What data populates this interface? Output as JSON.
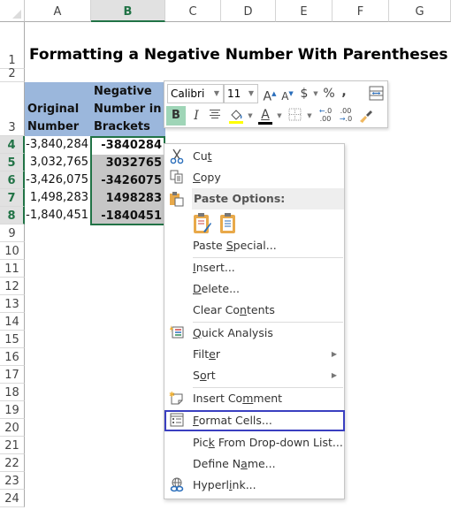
{
  "spreadsheet": {
    "columns": [
      "A",
      "B",
      "C",
      "D",
      "E",
      "F",
      "G"
    ],
    "selected_column": "B",
    "rows": [
      "1",
      "2",
      "3",
      "4",
      "5",
      "6",
      "7",
      "8",
      "9",
      "10",
      "11",
      "12",
      "13",
      "14",
      "15",
      "16",
      "17",
      "18",
      "19",
      "20",
      "21",
      "22",
      "23",
      "24"
    ],
    "selected_rows": [
      "4",
      "5",
      "6",
      "7",
      "8"
    ],
    "title": "Formatting a Negative Number With Parentheses",
    "header_a": [
      "Original",
      "Number"
    ],
    "header_b": [
      "Negative",
      "Number in",
      "Brackets"
    ],
    "original_numbers": [
      "-3,840,284",
      "3,032,765",
      "-3,426,075",
      "1,498,283",
      "-1,840,451"
    ],
    "bracket_numbers": [
      "-3840284",
      "3032765",
      "-3426075",
      "1498283",
      "-1840451"
    ],
    "header_fill_color": "#9bb7dc",
    "selection_color": "#217346"
  },
  "mini_toolbar": {
    "font_name": "Calibri",
    "font_size": "11",
    "increase_font_icon": "A˄",
    "decrease_font_icon": "A˅",
    "currency_icon": "$",
    "percent_icon": "%",
    "comma_icon": ",",
    "bold_label": "B",
    "italic_label": "I",
    "font_color_label": "A",
    "increase_decimal_label": "←.0\n.00",
    "decrease_decimal_label": ".00\n→.0"
  },
  "context_menu": {
    "items": [
      {
        "label": "Cut",
        "icon": "scissors-icon"
      },
      {
        "label": "Copy",
        "icon": "copy-icon"
      },
      {
        "label": "Paste Options:",
        "icon": "paste-icon",
        "header": true
      },
      {
        "label": "Paste Special..."
      },
      {
        "label": "Insert..."
      },
      {
        "label": "Delete..."
      },
      {
        "label": "Clear Contents"
      },
      {
        "label": "Quick Analysis",
        "icon": "quick-analysis-icon"
      },
      {
        "label": "Filter",
        "submenu": true
      },
      {
        "label": "Sort",
        "submenu": true
      },
      {
        "label": "Insert Comment",
        "icon": "comment-icon"
      },
      {
        "label": "Format Cells...",
        "icon": "format-cells-icon",
        "highlighted": true
      },
      {
        "label": "Pick From Drop-down List..."
      },
      {
        "label": "Define Name..."
      },
      {
        "label": "Hyperlink...",
        "icon": "hyperlink-icon"
      }
    ],
    "highlight_color": "#3a3fc0"
  }
}
